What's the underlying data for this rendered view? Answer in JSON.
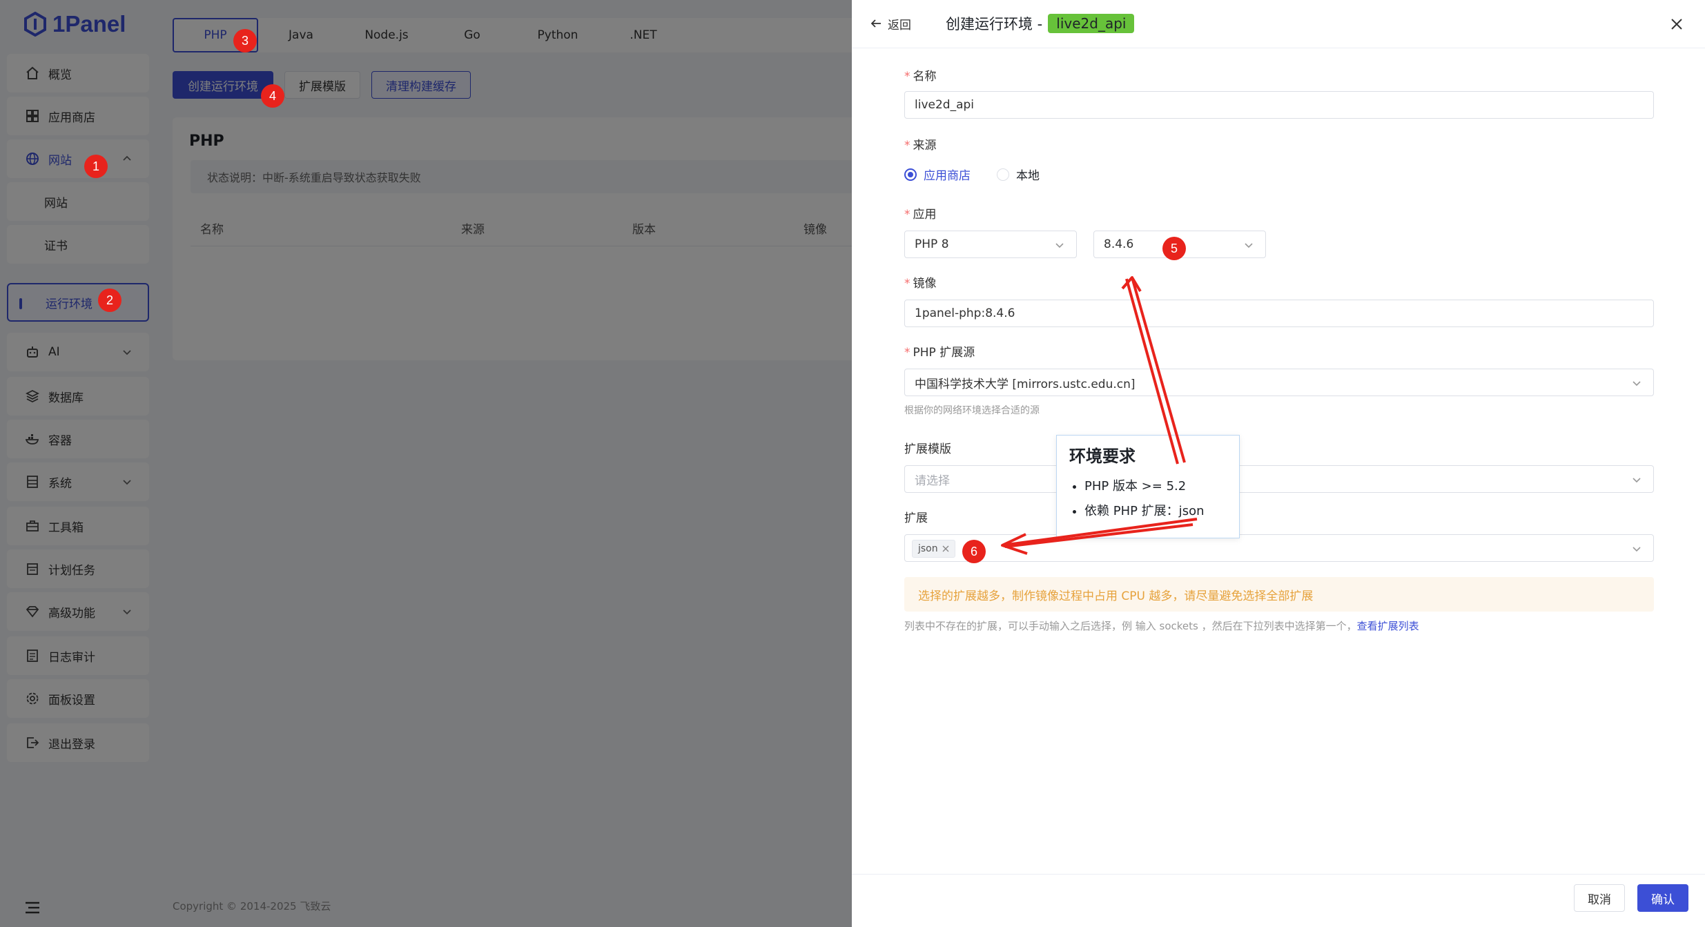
{
  "brand": {
    "name": "1Panel",
    "color": "#3c4fd6"
  },
  "sidebar": {
    "items": [
      {
        "label": "概览",
        "icon": "home-icon"
      },
      {
        "label": "应用商店",
        "icon": "grid-icon"
      },
      {
        "label": "网站",
        "icon": "globe-icon"
      },
      {
        "label": "网站"
      },
      {
        "label": "证书"
      },
      {
        "label": "运行环境"
      },
      {
        "label": "AI",
        "icon": "robot-icon"
      },
      {
        "label": "数据库",
        "icon": "layers-icon"
      },
      {
        "label": "容器",
        "icon": "whale-icon"
      },
      {
        "label": "系统",
        "icon": "server-icon"
      },
      {
        "label": "工具箱",
        "icon": "toolbox-icon"
      },
      {
        "label": "计划任务",
        "icon": "calendar-icon"
      },
      {
        "label": "高级功能",
        "icon": "diamond-icon"
      },
      {
        "label": "日志审计",
        "icon": "log-icon"
      },
      {
        "label": "面板设置",
        "icon": "gear-icon"
      },
      {
        "label": "退出登录",
        "icon": "logout-icon"
      }
    ]
  },
  "main": {
    "tabs": [
      "PHP",
      "Java",
      "Node.js",
      "Go",
      "Python",
      ".NET"
    ],
    "buttons": {
      "create": "创建运行环境",
      "ext_template": "扩展模版",
      "clear_cache": "清理构建缓存"
    },
    "card_title": "PHP",
    "notice": "状态说明：中断-系统重启导致状态获取失败",
    "columns": [
      "名称",
      "来源",
      "版本",
      "镜像"
    ],
    "footer": "Copyright © 2014-2025 飞致云"
  },
  "drawer": {
    "back": "返回",
    "title": "创建运行环境 -",
    "title_tag": "live2d_api",
    "name_label": "名称",
    "name_value": "live2d_api",
    "source_label": "来源",
    "source_options": [
      "应用商店",
      "本地"
    ],
    "source_selected": "应用商店",
    "app_label": "应用",
    "app_value": "PHP 8",
    "version_value": "8.4.6",
    "image_label": "镜像",
    "image_value": "1panel-php:8.4.6",
    "ext_source_label": "PHP 扩展源",
    "ext_source_value": "中国科学技术大学 [mirrors.ustc.edu.cn]",
    "ext_source_hint": "根据你的网络环境选择合适的源",
    "ext_template_label": "扩展模版",
    "ext_template_placeholder": "请选择",
    "ext_label": "扩展",
    "ext_chip": "json",
    "warning": "选择的扩展越多，制作镜像过程中占用 CPU 越多，请尽量避免选择全部扩展",
    "tip_text": "列表中不存在的扩展，可以手动输入之后选择，例 输入 sockets ，然后在下拉列表中选择第一个，",
    "tip_link": "查看扩展列表",
    "cancel": "取消",
    "confirm": "确认"
  },
  "annotations": {
    "badges": [
      "1",
      "2",
      "3",
      "4",
      "5",
      "6"
    ],
    "callout_title": "环境要求",
    "callout_items": [
      "PHP 版本 >= 5.2",
      "依赖 PHP 扩展：json"
    ],
    "arrow_color": "#e8231c"
  }
}
